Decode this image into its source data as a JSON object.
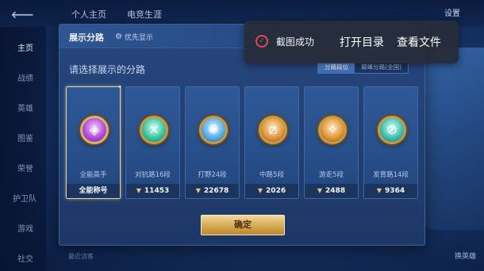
{
  "background": {
    "tabs": [
      "个人主页",
      "电竞生涯"
    ],
    "settings": "设置",
    "nav": [
      "主页",
      "战绩",
      "英雄",
      "图鉴",
      "荣誉",
      "护卫队",
      "游戏",
      "社交"
    ],
    "bottom_hint": "最近访客",
    "bottom_right": "换英雄"
  },
  "panel": {
    "title": "展示分路",
    "priority_label": "优先显示",
    "prompt": "请选择展示的分路",
    "segments": [
      "分路段位",
      "巅峰分路(全国)"
    ],
    "confirm_label": "确定",
    "cards": [
      {
        "label": "全能高手",
        "value": "全能称号",
        "badge_color": "#b34ee0",
        "badge_icon": "all-round-icon",
        "selected": true
      },
      {
        "label": "对抗路16段",
        "value": "11453",
        "badge_color": "#39c8a1",
        "badge_icon": "clash-lane-icon",
        "selected": false
      },
      {
        "label": "打野24段",
        "value": "22678",
        "badge_color": "#5ab1e6",
        "badge_icon": "jungle-icon",
        "selected": false
      },
      {
        "label": "中路5段",
        "value": "2026",
        "badge_color": "#e29a3e",
        "badge_icon": "mid-lane-icon",
        "selected": false
      },
      {
        "label": "游走5段",
        "value": "2488",
        "badge_color": "#e29a3e",
        "badge_icon": "roam-icon",
        "selected": false
      },
      {
        "label": "发育路14段",
        "value": "9364",
        "badge_color": "#3cc3b4",
        "badge_icon": "farm-lane-icon",
        "selected": false
      }
    ]
  },
  "toast": {
    "message": "截图成功",
    "open_dir": "打开目录",
    "view_file": "查看文件",
    "accent": "#e04b4b"
  }
}
